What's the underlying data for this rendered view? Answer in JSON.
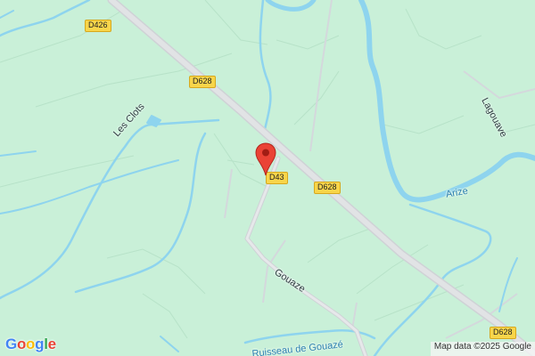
{
  "map": {
    "road_shields": {
      "d426": "D426",
      "d628_top": "D628",
      "d43": "D43",
      "d628_mid": "D628",
      "d628_bottom": "D628"
    },
    "place_labels": {
      "les_clots": "Les Clots",
      "gouaze": "Gouaze",
      "lagouave": "Lagouave",
      "arize": "Arize",
      "ruisseau": "Ruisseau de Gouazé"
    },
    "marker": {
      "icon": "map-pin-icon",
      "color": "#ea4335"
    },
    "colors": {
      "land": "#c9f0d8",
      "water": "#8ed4ee",
      "road": "#d7d7db",
      "shield": "#f8d54a"
    }
  },
  "branding": {
    "logo_text": [
      "G",
      "o",
      "o",
      "g",
      "l",
      "e"
    ]
  },
  "attribution": {
    "text": "Map data ©2025 Google"
  }
}
